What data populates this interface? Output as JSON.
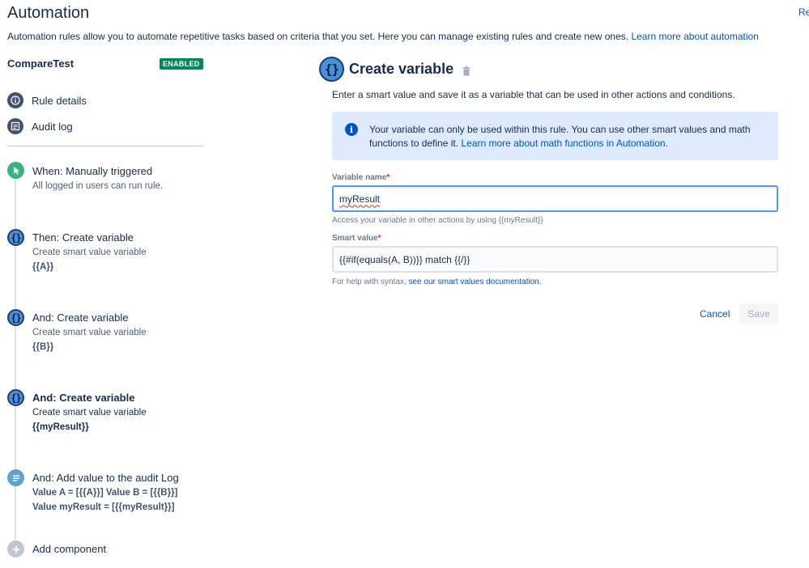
{
  "page": {
    "title": "Automation",
    "top_right_link": "Re",
    "intro_text": "Automation rules allow you to automate repetitive tasks based on criteria that you set. Here you can manage existing rules and create new ones.",
    "intro_link": "Learn more about automation"
  },
  "sidebar": {
    "rule_name": "CompareTest",
    "status_badge": "ENABLED",
    "nav": [
      {
        "label": "Rule details",
        "icon": "info-icon"
      },
      {
        "label": "Audit log",
        "icon": "audit-log-icon"
      }
    ],
    "components": [
      {
        "title": "When: Manually triggered",
        "subtitle": "All logged in users can run rule.",
        "icon": "trigger-icon"
      },
      {
        "title": "Then: Create variable",
        "subtitle": "Create smart value variable",
        "value": "{{A}}",
        "icon": "variable-icon"
      },
      {
        "title": "And: Create variable",
        "subtitle": "Create smart value variable",
        "value": "{{B}}",
        "icon": "variable-icon"
      },
      {
        "title": "And: Create variable",
        "subtitle": "Create smart value variable",
        "value": "{{myResult}}",
        "icon": "variable-icon",
        "selected": true
      },
      {
        "title": "And: Add value to the audit Log",
        "line1": "Value A = [{{A}}] Value B = [{{B}}]",
        "line2": "Value myResult = [{{myResult}}]",
        "icon": "log-icon"
      }
    ],
    "add_component": "Add component"
  },
  "main": {
    "icon_glyph": "{}",
    "title": "Create variable",
    "description": "Enter a smart value and save it as a variable that can be used in other actions and conditions.",
    "info": {
      "text": "Your variable can only be used within this rule. You can use other smart values and math functions to define it.",
      "link": "Learn more about math functions in Automation."
    },
    "variable_name": {
      "label": "Variable name",
      "required_mark": "*",
      "value": "myResult",
      "help": "Access your variable in other actions by using {{myResult}}"
    },
    "smart_value": {
      "label": "Smart value",
      "required_mark": "*",
      "value": "{{#if(equals(A, B))}} match {{/}}",
      "help_prefix": "For help with syntax,",
      "help_link": "see our smart values documentation."
    },
    "buttons": {
      "cancel": "Cancel",
      "save": "Save"
    }
  },
  "colors": {
    "accent": "#0052cc",
    "enabled_badge": "#00875a",
    "info_bg": "#deebff",
    "focus_border": "#4c9aff"
  }
}
